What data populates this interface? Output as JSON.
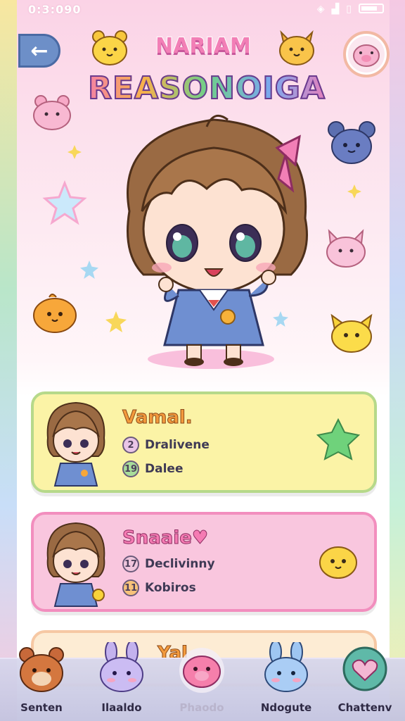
{
  "status_bar": {
    "time": "0:3:090"
  },
  "header": {
    "title_small": "NARIAM",
    "title_big": "REASONOIGA"
  },
  "cards": [
    {
      "name": "Vamal.",
      "stat1_icon": "2",
      "stat1": "Dralivene",
      "stat2_icon": "19",
      "stat2": "Dalee"
    },
    {
      "name": "Snaaie♥",
      "stat1_icon": "17",
      "stat1": "Declivinny",
      "stat2_icon": "11",
      "stat2": "Kobiros"
    },
    {
      "name": "Yal"
    }
  ],
  "bottom_nav": [
    {
      "label": "Senten",
      "icon": "bear-icon"
    },
    {
      "label": "Ilaaldo",
      "icon": "bunny-icon"
    },
    {
      "label": "Phaodo",
      "icon": "pig-icon"
    },
    {
      "label": "Ndogute",
      "icon": "rabbit-icon"
    },
    {
      "label": "Chattenv",
      "icon": "heart-icon"
    }
  ],
  "colors": {
    "accent": "#f27fb6",
    "card1": "#fbf3a6",
    "card2": "#f9c6de",
    "nav": "#d4d3ea"
  }
}
